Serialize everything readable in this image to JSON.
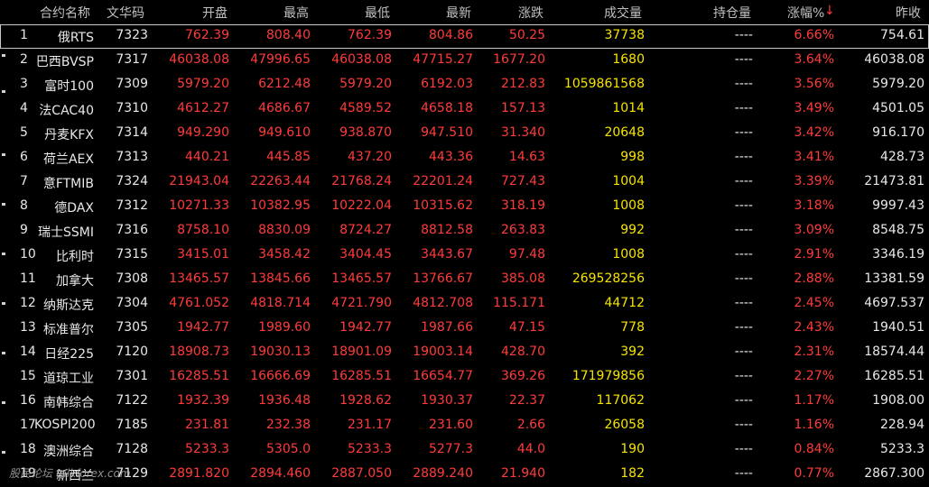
{
  "headers": {
    "name": "合约名称",
    "code": "文华码",
    "open": "开盘",
    "high": "最高",
    "low": "最低",
    "last": "最新",
    "change": "涨跌",
    "volume": "成交量",
    "open_interest": "持仓量",
    "pct": "涨幅%",
    "sort_indicator": "↓",
    "prev_close": "昨收"
  },
  "colors": {
    "up": "#ff3b3b",
    "volume": "#f5e400",
    "neutral": "#e8e8e8",
    "header": "#c0c0c0"
  },
  "rows": [
    {
      "idx": "1",
      "name": "俄RTS",
      "code": "7323",
      "open": "762.39",
      "high": "808.40",
      "low": "762.39",
      "last": "804.86",
      "change": "50.25",
      "volume": "37738",
      "oi": "----",
      "pct": "6.66%",
      "prev": "754.61"
    },
    {
      "idx": "2",
      "name": "巴西BVSP",
      "code": "7317",
      "open": "46038.08",
      "high": "47996.65",
      "low": "46038.08",
      "last": "47715.27",
      "change": "1677.20",
      "volume": "1680",
      "oi": "----",
      "pct": "3.64%",
      "prev": "46038.08"
    },
    {
      "idx": "3",
      "name": "富时100",
      "code": "7309",
      "open": "5979.20",
      "high": "6212.48",
      "low": "5979.20",
      "last": "6192.03",
      "change": "212.83",
      "volume": "1059861568",
      "oi": "----",
      "pct": "3.56%",
      "prev": "5979.20"
    },
    {
      "idx": "4",
      "name": "法CAC40",
      "code": "7310",
      "open": "4612.27",
      "high": "4686.67",
      "low": "4589.52",
      "last": "4658.18",
      "change": "157.13",
      "volume": "1014",
      "oi": "----",
      "pct": "3.49%",
      "prev": "4501.05"
    },
    {
      "idx": "5",
      "name": "丹麦KFX",
      "code": "7314",
      "open": "949.290",
      "high": "949.610",
      "low": "938.870",
      "last": "947.510",
      "change": "31.340",
      "volume": "20648",
      "oi": "----",
      "pct": "3.42%",
      "prev": "916.170"
    },
    {
      "idx": "6",
      "name": "荷兰AEX",
      "code": "7313",
      "open": "440.21",
      "high": "445.85",
      "low": "437.20",
      "last": "443.36",
      "change": "14.63",
      "volume": "998",
      "oi": "----",
      "pct": "3.41%",
      "prev": "428.73"
    },
    {
      "idx": "7",
      "name": "意FTMIB",
      "code": "7324",
      "open": "21943.04",
      "high": "22263.44",
      "low": "21768.24",
      "last": "22201.24",
      "change": "727.43",
      "volume": "1004",
      "oi": "----",
      "pct": "3.39%",
      "prev": "21473.81"
    },
    {
      "idx": "8",
      "name": "德DAX",
      "code": "7312",
      "open": "10271.33",
      "high": "10382.95",
      "low": "10222.04",
      "last": "10315.62",
      "change": "318.19",
      "volume": "1008",
      "oi": "----",
      "pct": "3.18%",
      "prev": "9997.43"
    },
    {
      "idx": "9",
      "name": "瑞士SSMI",
      "code": "7316",
      "open": "8758.10",
      "high": "8830.09",
      "low": "8724.27",
      "last": "8812.58",
      "change": "263.83",
      "volume": "992",
      "oi": "----",
      "pct": "3.09%",
      "prev": "8548.75"
    },
    {
      "idx": "10",
      "name": "比利时",
      "code": "7315",
      "open": "3415.01",
      "high": "3458.42",
      "low": "3404.45",
      "last": "3443.67",
      "change": "97.48",
      "volume": "1008",
      "oi": "----",
      "pct": "2.91%",
      "prev": "3346.19"
    },
    {
      "idx": "11",
      "name": "加拿大",
      "code": "7308",
      "open": "13465.57",
      "high": "13845.66",
      "low": "13465.57",
      "last": "13766.67",
      "change": "385.08",
      "volume": "269528256",
      "oi": "----",
      "pct": "2.88%",
      "prev": "13381.59"
    },
    {
      "idx": "12",
      "name": "纳斯达克",
      "code": "7304",
      "open": "4761.052",
      "high": "4818.714",
      "low": "4721.790",
      "last": "4812.708",
      "change": "115.171",
      "volume": "44712",
      "oi": "----",
      "pct": "2.45%",
      "prev": "4697.537"
    },
    {
      "idx": "13",
      "name": "标准普尔",
      "code": "7305",
      "open": "1942.77",
      "high": "1989.60",
      "low": "1942.77",
      "last": "1987.66",
      "change": "47.15",
      "volume": "778",
      "oi": "----",
      "pct": "2.43%",
      "prev": "1940.51"
    },
    {
      "idx": "14",
      "name": "日经225",
      "code": "7120",
      "open": "18908.73",
      "high": "19030.13",
      "low": "18901.09",
      "last": "19003.14",
      "change": "428.70",
      "volume": "392",
      "oi": "----",
      "pct": "2.31%",
      "prev": "18574.44"
    },
    {
      "idx": "15",
      "name": "道琼工业",
      "code": "7301",
      "open": "16285.51",
      "high": "16666.69",
      "low": "16285.51",
      "last": "16654.77",
      "change": "369.26",
      "volume": "171979856",
      "oi": "----",
      "pct": "2.27%",
      "prev": "16285.51"
    },
    {
      "idx": "16",
      "name": "南韩综合",
      "code": "7122",
      "open": "1932.39",
      "high": "1936.48",
      "low": "1928.62",
      "last": "1930.37",
      "change": "22.37",
      "volume": "117062",
      "oi": "----",
      "pct": "1.17%",
      "prev": "1908.00"
    },
    {
      "idx": "17",
      "name": "KOSPI200",
      "code": "7185",
      "open": "231.81",
      "high": "232.38",
      "low": "231.17",
      "last": "231.60",
      "change": "2.66",
      "volume": "26058",
      "oi": "----",
      "pct": "1.16%",
      "prev": "228.94"
    },
    {
      "idx": "18",
      "name": "澳洲综合",
      "code": "7128",
      "open": "5233.3",
      "high": "5305.0",
      "low": "5233.3",
      "last": "5277.3",
      "change": "44.0",
      "volume": "190",
      "oi": "----",
      "pct": "0.84%",
      "prev": "5233.3"
    },
    {
      "idx": "19",
      "name": "新西兰",
      "code": "7129",
      "open": "2891.820",
      "high": "2894.460",
      "low": "2887.050",
      "last": "2889.240",
      "change": "21.940",
      "volume": "182",
      "oi": "----",
      "pct": "0.77%",
      "prev": "2867.300"
    }
  ],
  "watermark": "股民论坛 talkforex.com"
}
